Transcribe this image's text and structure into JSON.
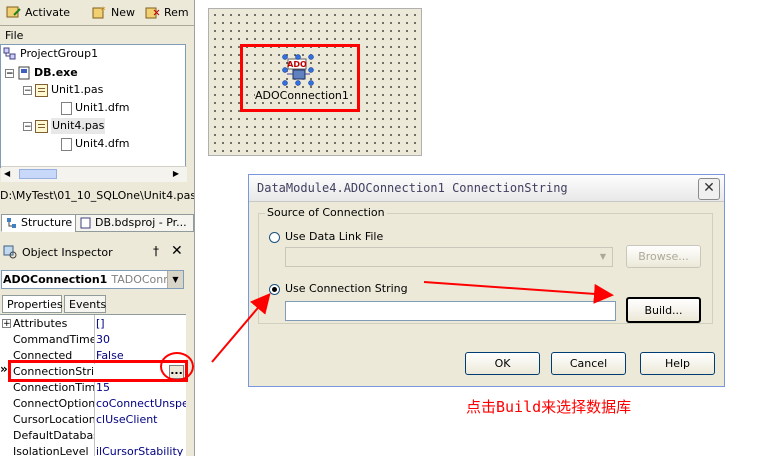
{
  "toolbar": {
    "activate_label": "Activate",
    "new_label": "New",
    "remove_label": "Rem"
  },
  "menu": {
    "file_label": "File"
  },
  "project_tree": {
    "items": [
      "ProjectGroup1",
      "DB.exe",
      "Unit1.pas",
      "Unit1.dfm",
      "Unit4.pas",
      "Unit4.dfm"
    ]
  },
  "path_text": "D:\\MyTest\\01_10_SQLOne\\Unit4.pas",
  "panel_tabs": {
    "structure_label": "Structure",
    "project_label": "DB.bdsproj - Pr..."
  },
  "object_inspector": {
    "title": "Object Inspector",
    "pin_glyph": "†",
    "close_glyph": "✕",
    "component_name": "ADOConnection1",
    "component_type": "TADOConnect",
    "tabs": [
      "Properties",
      "Events"
    ],
    "properties": [
      {
        "name": "Attributes",
        "value": "[]",
        "expander": "+"
      },
      {
        "name": "CommandTimeou",
        "value": "30",
        "expander": ""
      },
      {
        "name": "Connected",
        "value": "False",
        "expander": ""
      },
      {
        "name": "ConnectionString",
        "value": "",
        "expander": ""
      },
      {
        "name": "ConnectionTime",
        "value": "15",
        "expander": ""
      },
      {
        "name": "ConnectOptions",
        "value": "coConnectUnspeci",
        "expander": ""
      },
      {
        "name": "CursorLocation",
        "value": "clUseClient",
        "expander": ""
      },
      {
        "name": "DefaultDatabase",
        "value": "",
        "expander": ""
      },
      {
        "name": "IsolationLevel",
        "value": "ilCursorStability",
        "expander": ""
      }
    ],
    "selected_marker": "»",
    "ellipsis_label": "..."
  },
  "designer": {
    "component_label": "ADOConnection1",
    "icon_text": "ADO"
  },
  "dialog": {
    "title": "DataModule4.ADOConnection1 ConnectionString",
    "close_glyph": "✕",
    "group_label": "Source of Connection",
    "radio_link_label": "Use Data Link File",
    "radio_string_label": "Use Connection String",
    "browse_label": "Browse...",
    "build_label": "Build...",
    "ok_label": "OK",
    "cancel_label": "Cancel",
    "help_label": "Help",
    "selected_option": "Use Connection String"
  },
  "annotation": {
    "text": "点击Build来选择数据库",
    "color": "#ff0000"
  }
}
